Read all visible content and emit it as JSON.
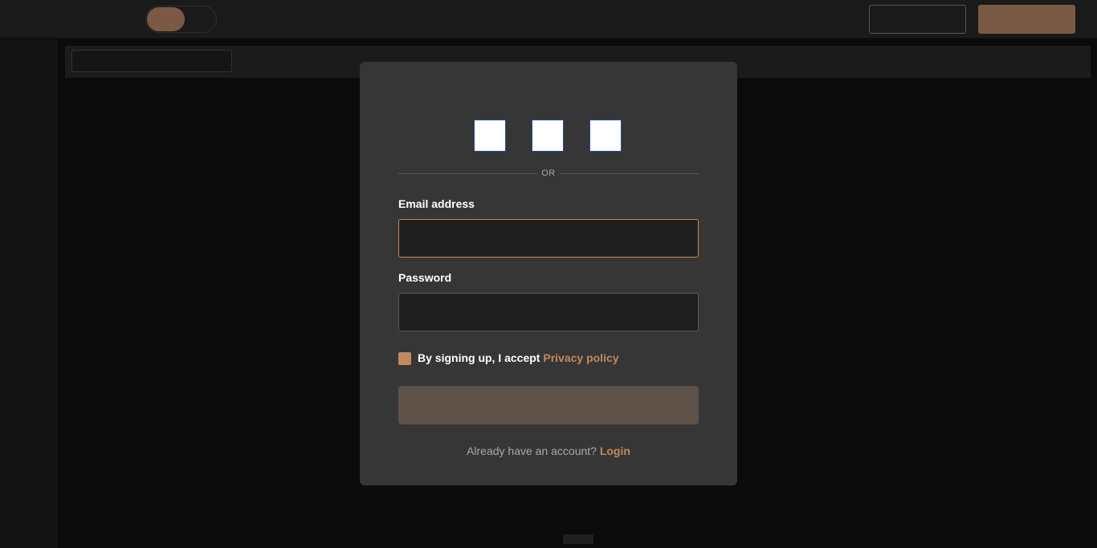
{
  "divider": {
    "text": "OR"
  },
  "form": {
    "email_label": "Email address",
    "email_value": "",
    "password_label": "Password",
    "password_value": "",
    "consent_text": "By signing up, I accept ",
    "consent_link": "Privacy policy",
    "checkbox_checked": true,
    "submit_label": ""
  },
  "footer": {
    "prompt": "Already have an account? ",
    "link": "Login"
  },
  "colors": {
    "accent": "#c4885a",
    "modal_bg": "#363636",
    "page_bg": "#0b0b0b",
    "submit_bg": "#5e5147"
  }
}
